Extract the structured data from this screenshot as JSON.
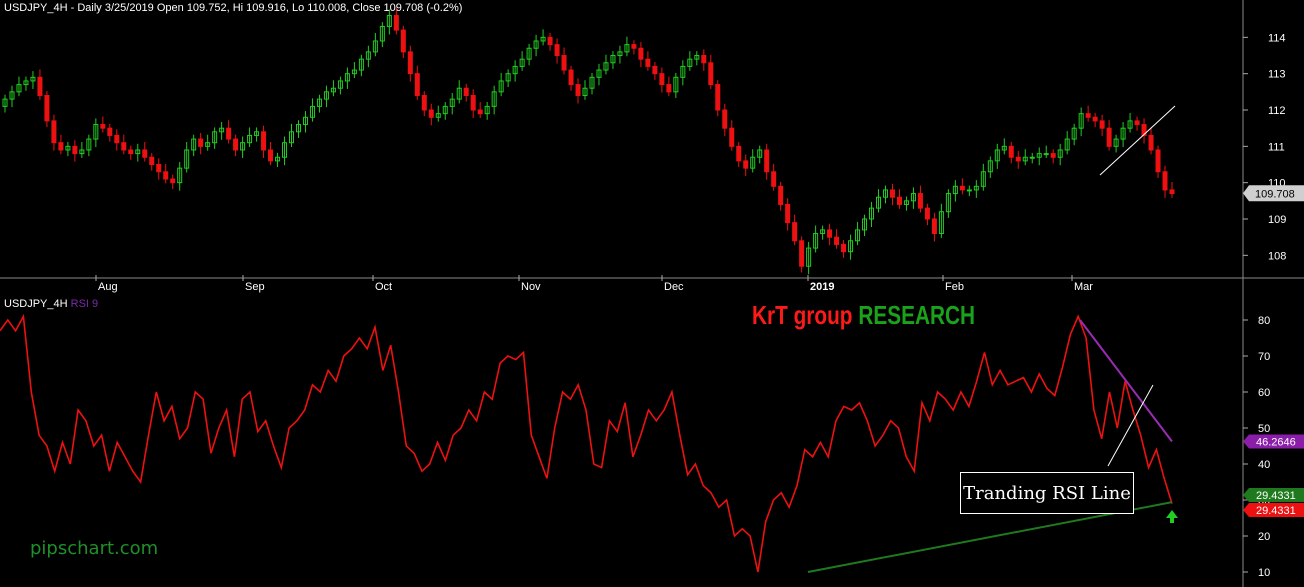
{
  "header": {
    "price_title": "USDJPY_4H - Daily 3/25/2019 Open 109.752, Hi 109.916, Lo 110.008, Close 109.708 (-0.2%)",
    "rsi_symbol": "USDJPY_4H",
    "rsi_name": "RSI 9"
  },
  "watermark": {
    "part1": "KrT group",
    "part2": "RESEARCH"
  },
  "site": "pipschart.com",
  "annotation": "Tranding RSI Line",
  "colors": {
    "bull": "#22cc22",
    "bear": "#ee1111",
    "rsi": "#ee1111",
    "purple_line": "#9b2bb3",
    "green_line": "#1f7a1f"
  },
  "chart_data": [
    {
      "type": "candlestick",
      "title": "USDJPY_4H - Daily 3/25/2019 Open 109.752, Hi 109.916, Lo 110.008, Close 109.708 (-0.2%)",
      "x_ticks": [
        "Aug",
        "Sep",
        "Oct",
        "Nov",
        "Dec",
        "2019",
        "Feb",
        "Mar"
      ],
      "y_ticks": [
        108,
        109,
        110,
        111,
        112,
        113,
        114
      ],
      "ylim": [
        107.3,
        115
      ],
      "last_price_label": "109.708",
      "closes": [
        112.3,
        112.5,
        112.7,
        112.8,
        112.9,
        112.4,
        111.7,
        111.1,
        110.9,
        111.0,
        110.8,
        110.9,
        111.2,
        111.6,
        111.5,
        111.3,
        111.1,
        110.9,
        110.8,
        110.9,
        110.7,
        110.5,
        110.3,
        110.1,
        110.0,
        110.4,
        110.9,
        111.2,
        111.0,
        111.1,
        111.4,
        111.5,
        111.2,
        110.9,
        111.1,
        111.3,
        111.4,
        110.9,
        110.6,
        110.7,
        111.1,
        111.4,
        111.6,
        111.8,
        112.1,
        112.3,
        112.5,
        112.6,
        112.8,
        113.0,
        113.1,
        113.4,
        113.6,
        113.9,
        114.3,
        114.6,
        114.2,
        113.6,
        113.0,
        112.4,
        112.0,
        111.8,
        111.9,
        112.1,
        112.3,
        112.6,
        112.4,
        112.0,
        111.9,
        112.1,
        112.5,
        112.8,
        113.0,
        113.2,
        113.4,
        113.7,
        113.9,
        114.0,
        113.8,
        113.5,
        113.1,
        112.7,
        112.4,
        112.6,
        112.9,
        113.1,
        113.3,
        113.5,
        113.6,
        113.8,
        113.7,
        113.4,
        113.2,
        113.0,
        112.7,
        112.5,
        112.9,
        113.2,
        113.4,
        113.5,
        113.3,
        112.7,
        112.0,
        111.5,
        111.0,
        110.6,
        110.4,
        110.7,
        110.9,
        110.3,
        109.9,
        109.4,
        108.9,
        108.4,
        107.7,
        108.2,
        108.6,
        108.7,
        108.5,
        108.3,
        108.1,
        108.4,
        108.7,
        109.0,
        109.3,
        109.6,
        109.8,
        109.6,
        109.4,
        109.5,
        109.7,
        109.3,
        109.0,
        108.6,
        109.2,
        109.7,
        109.9,
        109.8,
        109.8,
        109.9,
        110.3,
        110.6,
        110.9,
        111.0,
        110.7,
        110.6,
        110.7,
        110.7,
        110.8,
        110.8,
        110.7,
        110.9,
        111.2,
        111.5,
        111.9,
        111.8,
        111.7,
        111.5,
        111.0,
        111.2,
        111.5,
        111.7,
        111.6,
        111.3,
        110.9,
        110.3,
        109.8,
        109.7
      ]
    },
    {
      "type": "line",
      "title": "USDJPY_4H RSI 9",
      "y_ticks": [
        10,
        20,
        30,
        40,
        50,
        60,
        70,
        80
      ],
      "ylim": [
        9,
        86
      ],
      "series": [
        {
          "name": "RSI 9",
          "values": [
            77,
            80,
            77,
            81,
            60,
            48,
            45,
            38,
            46,
            40,
            55,
            52,
            45,
            48,
            38,
            46,
            42,
            38,
            35,
            48,
            60,
            52,
            56,
            47,
            50,
            60,
            58,
            43,
            50,
            55,
            42,
            58,
            60,
            49,
            52,
            45,
            39,
            50,
            52,
            55,
            62,
            60,
            66,
            63,
            70,
            72,
            75,
            72,
            78,
            66,
            73,
            60,
            45,
            43,
            38,
            40,
            46,
            41,
            48,
            50,
            55,
            52,
            60,
            58,
            68,
            70,
            69,
            71,
            48,
            42,
            36,
            50,
            60,
            58,
            62,
            55,
            40,
            39,
            52,
            49,
            57,
            42,
            48,
            55,
            52,
            55,
            60,
            48,
            37,
            40,
            34,
            32,
            28,
            30,
            20,
            22,
            20,
            10,
            24,
            30,
            32,
            28,
            34,
            44,
            42,
            46,
            42,
            52,
            56,
            55,
            57,
            52,
            45,
            48,
            52,
            50,
            42,
            38,
            57,
            52,
            60,
            58,
            55,
            60,
            56,
            63,
            71,
            62,
            66,
            62,
            63,
            64,
            60,
            65,
            61,
            59,
            67,
            76,
            81,
            75,
            55,
            47,
            60,
            50,
            63,
            55,
            48,
            39,
            44,
            36,
            29
          ]
        },
        {
          "name": "Resistance line",
          "values": [
            80,
            46.26
          ]
        },
        {
          "name": "Support line",
          "values": [
            10,
            29.4
          ]
        }
      ],
      "value_labels": [
        "46.2646",
        "29.4331",
        "29.4331"
      ]
    }
  ]
}
